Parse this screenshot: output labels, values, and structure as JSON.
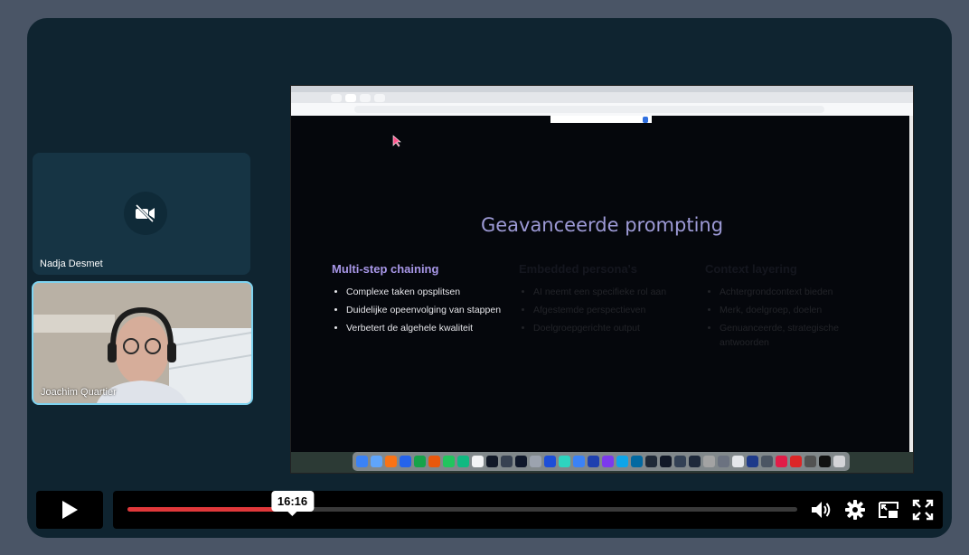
{
  "participants": {
    "nadja": {
      "name": "Nadja Desmet",
      "camera_icon": "video-off-icon"
    },
    "joachim": {
      "name": "Joachim Quartier"
    }
  },
  "shared_screen": {
    "slide": {
      "title": "Geavanceerde prompting",
      "columns": [
        {
          "heading": "Multi-step chaining",
          "items": [
            "Complexe taken opsplitsen",
            "Duidelijke opeenvolging van stappen",
            "Verbetert de algehele kwaliteit"
          ]
        },
        {
          "heading": "Embedded persona's",
          "items": [
            "AI neemt een specifieke rol aan",
            "Afgestemde perspectieven",
            "Doelgroepgerichte output"
          ]
        },
        {
          "heading": "Context layering",
          "items": [
            "Achtergrondcontext bieden",
            "Merk, doelgroep, doelen",
            "Genuanceerde, strategische antwoorden"
          ]
        }
      ]
    }
  },
  "player": {
    "current_time_tooltip": "16:16",
    "progress_fraction": 0.249,
    "colors": {
      "progress": "#e0383a",
      "accent_border": "#7ed3f0",
      "slide_title": "#9d9ad6",
      "column_heading": "#a897e8"
    },
    "icons": [
      "play-icon",
      "volume-icon",
      "gear-icon",
      "picture-in-picture-icon",
      "fullscreen-icon"
    ]
  }
}
